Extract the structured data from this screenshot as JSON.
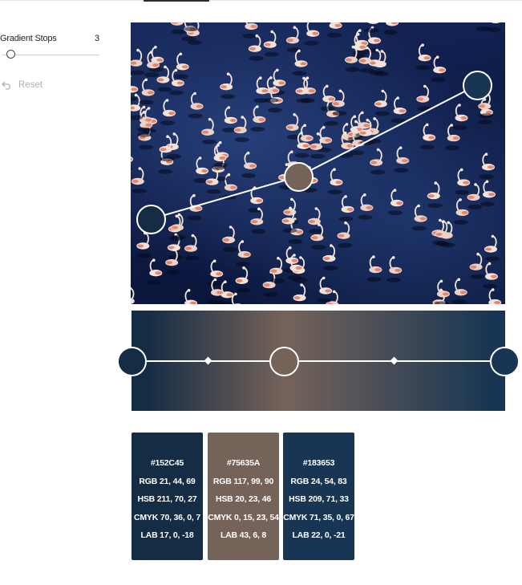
{
  "controls": {
    "gradient_stops_label": "Gradient Stops",
    "gradient_stops_value": "3",
    "gradient_stops_fraction": 0.0,
    "reset_label": "Reset"
  },
  "gradient": {
    "stop_colors": [
      "#152C45",
      "#75635A",
      "#183653"
    ]
  },
  "swatches": [
    {
      "color": "#152C45",
      "hex": "#152C45",
      "rgb": "RGB 21, 44, 69",
      "hsb": "HSB 211, 70, 27",
      "cmyk": "CMYK 70, 36, 0, 7",
      "lab": "LAB 17, 0, -18"
    },
    {
      "color": "#75635A",
      "hex": "#75635A",
      "rgb": "RGB 117, 99, 90",
      "hsb": "HSB 20, 23, 46",
      "cmyk": "CMYK 0, 15, 23, 54",
      "lab": "LAB 43, 6, 8"
    },
    {
      "color": "#183653",
      "hex": "#183653",
      "rgb": "RGB 24, 54, 83",
      "hsb": "HSB 209, 71, 33",
      "cmyk": "CMYK 71, 35, 0, 67",
      "lab": "LAB 22, 0, -21"
    }
  ],
  "icons": {
    "reset": "undo-arrow-icon"
  }
}
